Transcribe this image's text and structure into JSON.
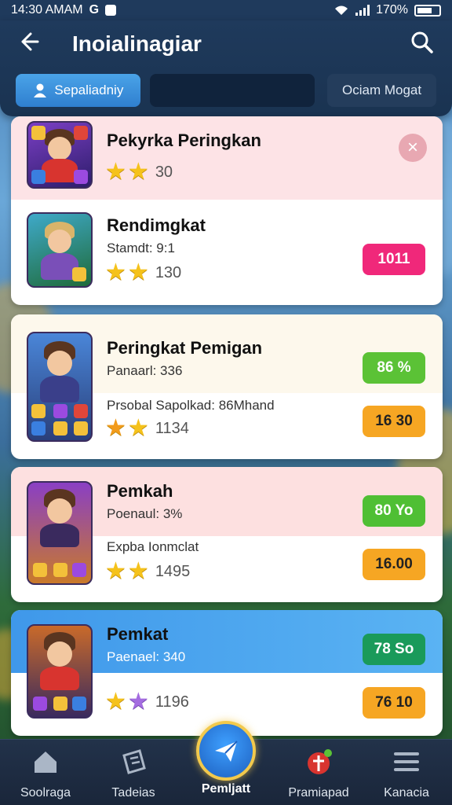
{
  "status_bar": {
    "time": "14:30 AMAM",
    "carrier_icon": "google-g-icon",
    "battery": "170%"
  },
  "header": {
    "title": "Inoialinagiar",
    "tabs": [
      {
        "label": "Sepaliadniy",
        "icon": "user-icon"
      },
      {
        "label": ""
      },
      {
        "label": "Ociam Mogat"
      }
    ]
  },
  "cards": [
    {
      "name": "Pekyrka Peringkan",
      "sub": "",
      "sub2": "",
      "stars_value": "30",
      "badge_top": "",
      "badge_bottom": "",
      "dismiss": "×"
    },
    {
      "name": "Rendimgkat",
      "sub": "Stamdt: 9:1",
      "sub2": "",
      "stars_value": "130",
      "badge_top": "",
      "badge_bottom": "1011",
      "badge_bottom_color": "#f0287a"
    },
    {
      "name": "Peringkat Pemigan",
      "sub": "Panaarl: 336",
      "sub2": "Prsobal Sapolkad: 86Mhand",
      "stars_value": "1134",
      "badge_top": "86 %",
      "badge_top_color": "#5bc236",
      "badge_bottom": "16 30",
      "badge_bottom_color": "#f6a623"
    },
    {
      "name": "Pemkah",
      "sub": "Poenaul: 3%",
      "sub2": "Expba Ionmclat",
      "stars_value": "1495",
      "badge_top": "80 Yo",
      "badge_top_color": "#4fbf34",
      "badge_bottom": "16.00",
      "badge_bottom_color": "#f6a623"
    },
    {
      "name": "Pemkat",
      "sub": "Paenael: 340",
      "sub2": "",
      "stars_value": "1196",
      "badge_top": "78 So",
      "badge_top_color": "#1a9a5a",
      "badge_bottom": "76 10",
      "badge_bottom_color": "#f6a623"
    }
  ],
  "bottom_nav": [
    {
      "label": "Soolraga",
      "icon": "home-icon"
    },
    {
      "label": "Tadeias",
      "icon": "ticket-icon"
    },
    {
      "label": "Pemljatt",
      "icon": "send-icon"
    },
    {
      "label": "Pramiapad",
      "icon": "gift-icon"
    },
    {
      "label": "Kanacia",
      "icon": "menu-icon"
    }
  ],
  "colors": {
    "header_bg": "#1f3a5c",
    "tab_active": "#3b8fde",
    "highlight_row": "#4aa3ef",
    "pink_row": "#fde3e6"
  }
}
